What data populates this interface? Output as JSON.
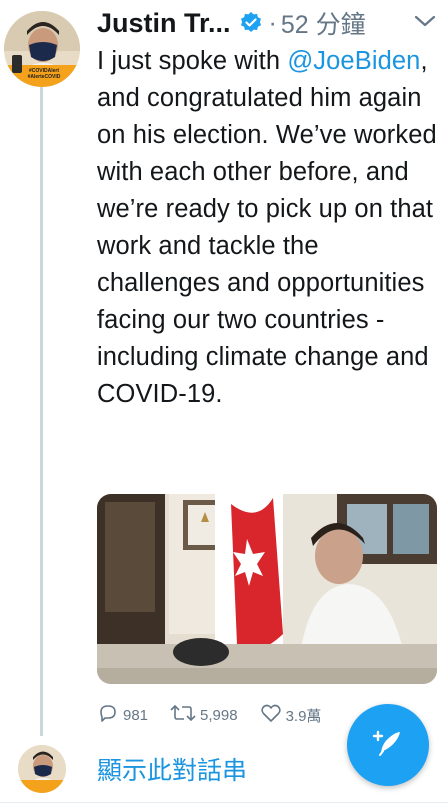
{
  "tweet": {
    "author_name": "Justin Tr...",
    "separator": "·",
    "time": "52 分鐘",
    "text_before": "I just spoke with ",
    "mention": "@JoeBiden",
    "text_after": ", and congratulated him again on his election. We’ve worked with each other before, and we’re ready to pick up on that work and tackle the challenges and opportunities facing our two countries - including climate change and COVID-19."
  },
  "avatar": {
    "badge_text": "#COVIDAlert #AlerteCOVID"
  },
  "actions": {
    "replies": "981",
    "retweets": "5,998",
    "likes": "3.9萬"
  },
  "thread": {
    "show_thread_label": "顯示此對話串"
  },
  "colors": {
    "accent": "#1da1f2",
    "link": "#1b95e0",
    "muted": "#657786",
    "thread_line": "#ccd6dd"
  },
  "icons": {
    "verified": "verified-badge-icon",
    "more": "chevron-down-icon",
    "reply": "reply-icon",
    "retweet": "retweet-icon",
    "like": "heart-icon",
    "compose": "compose-tweet-icon"
  }
}
